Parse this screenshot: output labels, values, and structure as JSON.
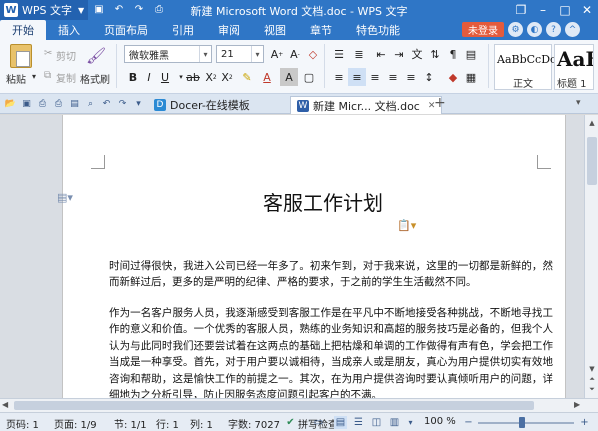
{
  "titlebar": {
    "app_name": "WPS 文字",
    "doc_title": "新建 Microsoft Word 文档.doc - WPS 文字",
    "icons": [
      "save-icon",
      "undo-icon",
      "redo-icon",
      "print-icon",
      "menu-icon",
      "minimize-icon",
      "maximize-icon",
      "close-icon"
    ]
  },
  "menu_tabs": [
    "开始",
    "插入",
    "页面布局",
    "引用",
    "审阅",
    "视图",
    "章节",
    "特色功能"
  ],
  "login_label": "未登录",
  "ribbon": {
    "paste": "粘贴",
    "cut": "剪切",
    "copy": "复制",
    "format_painter": "格式刷",
    "font_name": "微软雅黑",
    "font_size": "21",
    "style1_preview": "AaBbCcDc",
    "style1_label": "正文",
    "style2_preview": "AaB",
    "style2_label": "标题 1"
  },
  "doc_tabs": {
    "tab1": "Docer-在线模板",
    "tab2": "新建 Micr... 文档.doc",
    "add": "+"
  },
  "document": {
    "heading": "客服工作计划",
    "para1": "时间过得很快，我进入公司已经一年多了。初来乍到，对于我来说，这里的一切都是新鲜的，然而新鲜过后，更多的是严明的纪律、严格的要求，于之前的学生生活截然不同。",
    "para2": "作为一名客户服务人员，我逐渐感受到客服工作是在平凡中不断地接受各种挑战，不断地寻找工作的意义和价值。一个优秀的客服人员，熟练的业务知识和高超的服务技巧是必备的，但我个人认为与此同时我们还要尝试着在这两点的基础上把枯燥和单调的工作做得有声有色，学会把工作当成是一种享受。首先，对于用户要以诚相待，当成亲人或是朋友，真心为用户提供切实有效地咨询和帮助，这是愉快工作的前提之一。其次，在为用户提供咨询时要认真倾听用户的问题，详细地为之分析引导，防止因服务态度问题引起客户的不满。"
  },
  "statusbar": {
    "page_code": "页码: 1",
    "page": "页面: 1/9",
    "section": "节: 1/1",
    "row": "行: 1",
    "col": "列: 1",
    "word_count": "字数: 7027",
    "spell_check": "拼写检查",
    "zoom": "100 %"
  }
}
